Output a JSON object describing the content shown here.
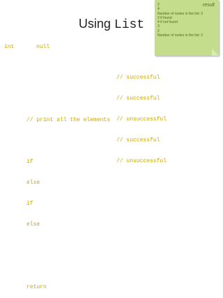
{
  "slide": {
    "title_text": "Using ",
    "title_code": "List",
    "stray_left": "int",
    "stray_mid": "null"
  },
  "comments": [
    "// successful",
    "// successful",
    "// unsuccessful",
    "// successful",
    "// unsuccessful"
  ],
  "left_code": {
    "print_comment": "// print all the elements",
    "keywords": [
      "if",
      "else",
      "if",
      "else"
    ],
    "return_kw": "return"
  },
  "note": {
    "title": "result",
    "lines": [
      "2",
      "4",
      "Number of nodes in the list: 3",
      "2 if found",
      "4 if not found",
      "3",
      "2",
      "Number of nodes in the list: 2"
    ]
  }
}
